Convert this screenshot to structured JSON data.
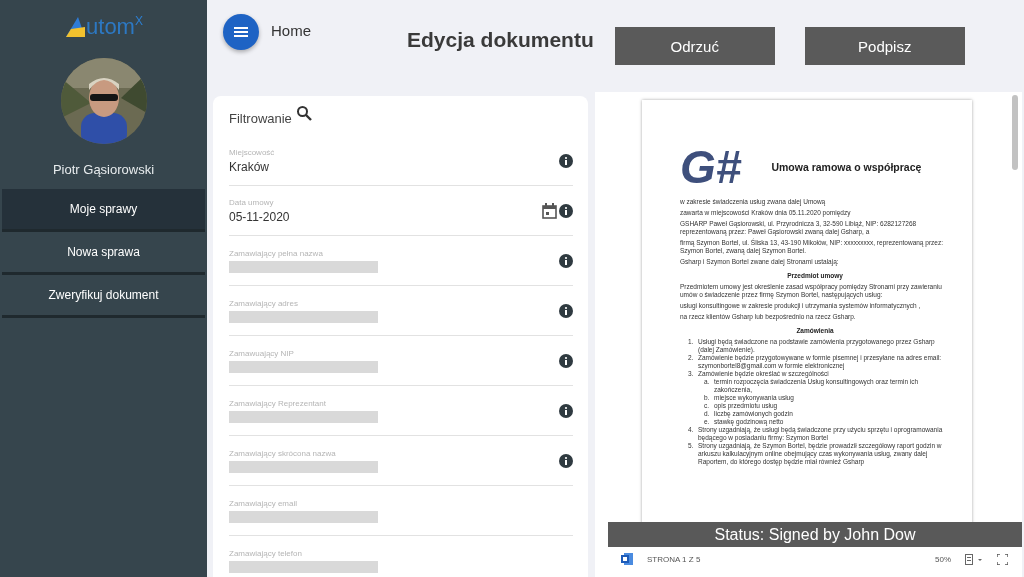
{
  "sidebar": {
    "logo": {
      "text": "utom",
      "sup": "X"
    },
    "user_name": "Piotr Gąsiorowski",
    "items": [
      {
        "label": "Moje sprawy",
        "selected": true
      },
      {
        "label": "Nowa sprawa",
        "selected": false
      },
      {
        "label": "Zweryfikuj dokument",
        "selected": false
      }
    ]
  },
  "header": {
    "breadcrumb": "Home",
    "title": "Edycja dokumentu",
    "buttons": [
      "Odrzuć",
      "Podpisz"
    ]
  },
  "filter": {
    "title": "Filtrowanie",
    "fields": [
      {
        "label": "Miejscowość",
        "value": "Kraków",
        "kind": "text",
        "redacted": false,
        "info": true
      },
      {
        "label": "Data umowy",
        "value": "05-11-2020",
        "kind": "date",
        "redacted": false,
        "info": true
      },
      {
        "label": "Zamawiający pełna nazwa",
        "kind": "text",
        "redacted": true,
        "info": true
      },
      {
        "label": "Zamawiający adres",
        "kind": "text",
        "redacted": true,
        "info": true
      },
      {
        "label": "Zamawuający NIP",
        "kind": "text",
        "redacted": true,
        "info": true
      },
      {
        "label": "Zamawiający Reprezentant",
        "kind": "text",
        "redacted": true,
        "info": true
      },
      {
        "label": "Zamawiający skrócona nazwa",
        "kind": "text",
        "redacted": true,
        "info": true
      },
      {
        "label": "Zamawiający email",
        "kind": "text",
        "redacted": true,
        "info": false
      },
      {
        "label": "Zamawiający telefon",
        "kind": "text",
        "redacted": true,
        "info": false
      }
    ]
  },
  "document": {
    "logo": "G#",
    "title": "Umowa ramowa o współpracę",
    "blocks": [
      {
        "kind": "para",
        "text": "w zakresie świadczenia usług zwana dalej Umową"
      },
      {
        "kind": "para",
        "text": "zawarta w miejscowości Kraków dnia 05.11.2020 pomiędzy"
      },
      {
        "kind": "para",
        "text": "GSHARP Paweł Gąsiorowski, ul. Przyrodnicza 3, 32-590 Libiąż, NIP: 6282127268 reprezentowaną przez: Paweł Gąsiorowski zwaną dalej Gsharp, a"
      },
      {
        "kind": "para",
        "text": "firmą Szymon Bortel, ul. Śliska 13, 43-190 Mikołów, NIP: xxxxxxxxx, reprezentowaną przez: Szymon Bortel, zwaną dalej Szymon Bortel."
      },
      {
        "kind": "para",
        "text": "Gsharp i Szymon Bortel zwane dalej Stronami ustalają:"
      },
      {
        "kind": "heading",
        "text": "Przedmiot umowy"
      },
      {
        "kind": "para",
        "text": "Przedmiotem umowy jest określenie zasad współpracy pomiędzy Stronami przy zawieraniu umów o świadczenie przez firmę Szymon Bortel, następujących usług:"
      },
      {
        "kind": "para",
        "text": "usługi konsultingowe w zakresie produkcji i utrzymania systemów informatycznych ,"
      },
      {
        "kind": "para",
        "text": "na rzecz klientów Gsharp lub bezpośrednio na rzecz Gsharp."
      },
      {
        "kind": "heading",
        "text": "Zamówienia"
      },
      {
        "kind": "list",
        "items": [
          {
            "marker": "1.",
            "text": "Usługi będą świadczone na podstawie zamówienia przygotowanego przez Gsharp (dalej Zamówienie)."
          },
          {
            "marker": "2.",
            "text": "Zamówienie będzie przygotowywane w formie pisemnej i przesyłane na adres email: szymonbortel8@gmail.com w formie elektronicznej"
          },
          {
            "marker": "3.",
            "text": "Zamówienie będzie określać w szczególności",
            "children": [
              {
                "marker": "a.",
                "text": "termin rozpoczęcia świadczenia Usług konsultingowych oraz termin ich zakończenia,"
              },
              {
                "marker": "b.",
                "text": "miejsce wykonywania usług"
              },
              {
                "marker": "c.",
                "text": "opis przedmiotu usług"
              },
              {
                "marker": "d.",
                "text": "liczbę zamówionych godzin"
              },
              {
                "marker": "e.",
                "text": "stawkę godzinową netto"
              }
            ]
          },
          {
            "marker": "4.",
            "text": "Strony uzgadniają, że usługi będą świadczone przy użyciu sprzętu i oprogramowania będącego w posiadaniu firmy: Szymon Bortel"
          },
          {
            "marker": "5.",
            "text": "Strony uzgadniają, że Szymon Bortel, będzie prowadził szczegółowy raport godzin w arkuszu kalkulacyjnym online obejmujący czas wykonywania usług, zwany dalej Raportem, do którego dostęp będzie miał również Gsharp"
          }
        ]
      }
    ],
    "status": "Status: Signed by John Dow",
    "page_label": "STRONA 1 Z 5",
    "zoom": "50%"
  }
}
